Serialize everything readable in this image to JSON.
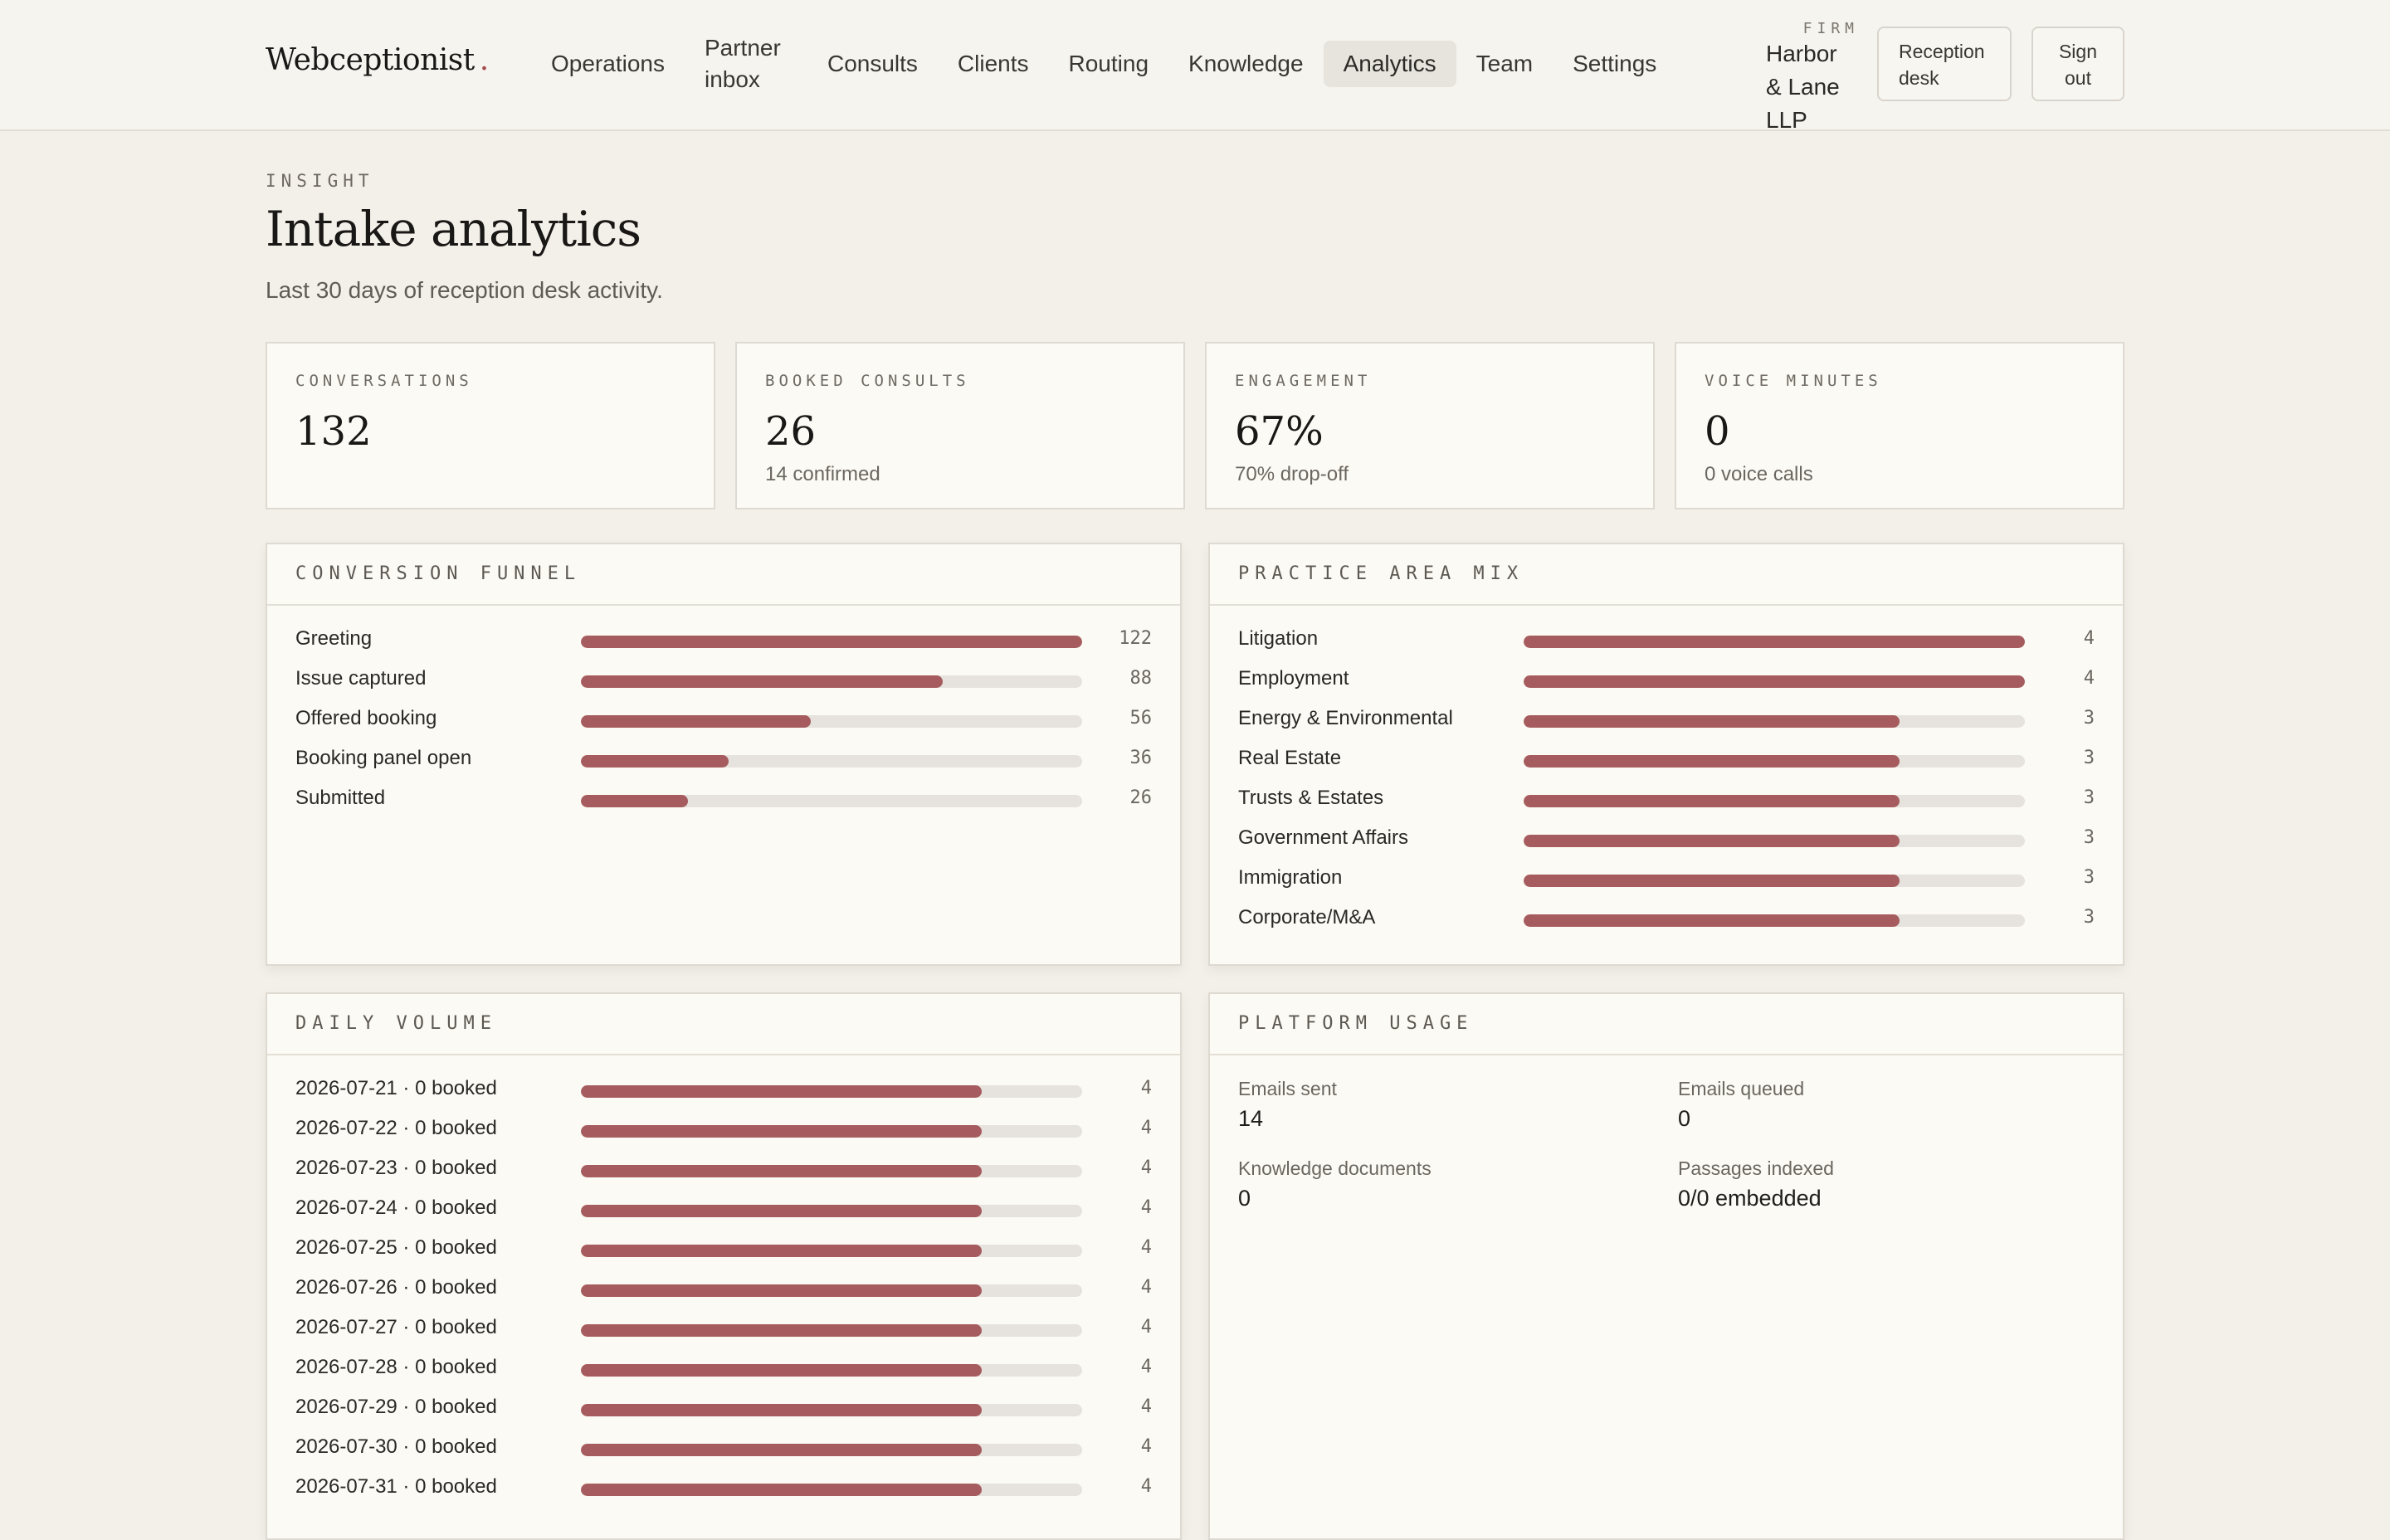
{
  "app": {
    "brand": "Webceptionist",
    "brand_dot": ".",
    "nav": [
      {
        "label": "Operations",
        "active": false
      },
      {
        "label": "Partner inbox",
        "active": false
      },
      {
        "label": "Consults",
        "active": false
      },
      {
        "label": "Clients",
        "active": false
      },
      {
        "label": "Routing",
        "active": false
      },
      {
        "label": "Knowledge",
        "active": false
      },
      {
        "label": "Analytics",
        "active": true
      },
      {
        "label": "Team",
        "active": false
      },
      {
        "label": "Settings",
        "active": false
      }
    ],
    "firm_label": "FIRM",
    "firm_name": "Harbor & Lane LLP",
    "reception_desk_label": "Reception desk",
    "sign_out_label": "Sign out"
  },
  "page": {
    "eyebrow": "INSIGHT",
    "title": "Intake analytics",
    "subtitle": "Last 30 days of reception desk activity."
  },
  "stats": [
    {
      "label": "CONVERSATIONS",
      "value": "132",
      "sub": ""
    },
    {
      "label": "BOOKED CONSULTS",
      "value": "26",
      "sub": "14 confirmed"
    },
    {
      "label": "ENGAGEMENT",
      "value": "67%",
      "sub": "70% drop-off"
    },
    {
      "label": "VOICE MINUTES",
      "value": "0",
      "sub": "0 voice calls"
    }
  ],
  "funnel": {
    "title": "CONVERSION FUNNEL",
    "max": 122,
    "rows": [
      {
        "label": "Greeting",
        "value": 122
      },
      {
        "label": "Issue captured",
        "value": 88
      },
      {
        "label": "Offered booking",
        "value": 56
      },
      {
        "label": "Booking panel open",
        "value": 36
      },
      {
        "label": "Submitted",
        "value": 26
      }
    ]
  },
  "practice": {
    "title": "PRACTICE AREA MIX",
    "max": 4,
    "rows": [
      {
        "label": "Litigation",
        "value": 4
      },
      {
        "label": "Employment",
        "value": 4
      },
      {
        "label": "Energy & Environmental",
        "value": 3
      },
      {
        "label": "Real Estate",
        "value": 3
      },
      {
        "label": "Trusts & Estates",
        "value": 3
      },
      {
        "label": "Government Affairs",
        "value": 3
      },
      {
        "label": "Immigration",
        "value": 3
      },
      {
        "label": "Corporate/M&A",
        "value": 3
      }
    ]
  },
  "daily": {
    "title": "DAILY VOLUME",
    "max": 5,
    "rows": [
      {
        "label": "2026-07-21 · 0 booked",
        "value": 4
      },
      {
        "label": "2026-07-22 · 0 booked",
        "value": 4
      },
      {
        "label": "2026-07-23 · 0 booked",
        "value": 4
      },
      {
        "label": "2026-07-24 · 0 booked",
        "value": 4
      },
      {
        "label": "2026-07-25 · 0 booked",
        "value": 4
      },
      {
        "label": "2026-07-26 · 0 booked",
        "value": 4
      },
      {
        "label": "2026-07-27 · 0 booked",
        "value": 4
      },
      {
        "label": "2026-07-28 · 0 booked",
        "value": 4
      },
      {
        "label": "2026-07-29 · 0 booked",
        "value": 4
      },
      {
        "label": "2026-07-30 · 0 booked",
        "value": 4
      },
      {
        "label": "2026-07-31 · 0 booked",
        "value": 4
      }
    ]
  },
  "usage": {
    "title": "PLATFORM USAGE",
    "items": [
      {
        "label": "Emails sent",
        "value": "14"
      },
      {
        "label": "Emails queued",
        "value": "0"
      },
      {
        "label": "Knowledge documents",
        "value": "0"
      },
      {
        "label": "Passages indexed",
        "value": "0/0 embedded"
      }
    ]
  },
  "colors": {
    "accent": "#a65c5e",
    "track": "#e6e3de",
    "background": "#f3f0e9",
    "card": "#fcfaf4"
  }
}
